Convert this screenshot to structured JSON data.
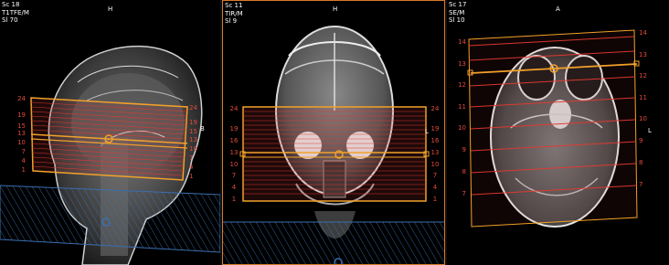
{
  "colors": {
    "slice_line": "#e23a2e",
    "stack_box": "#f2a12a",
    "saturation_band": "#3a6fb0",
    "background": "#000000"
  },
  "viewports": [
    {
      "name": "sagittal",
      "info": {
        "series": "Sc 18",
        "sequence": "T1TFE/M",
        "slice": "Sl 70"
      },
      "orientation_top": "H",
      "orientation_right": "B",
      "slice_labels_left": [
        "24",
        "19",
        "15",
        "13",
        "10",
        "7",
        "4",
        "1"
      ],
      "slice_labels_right": [
        "24",
        "19",
        "15",
        "13",
        "10",
        "7",
        "4",
        "1"
      ]
    },
    {
      "name": "coronal",
      "info": {
        "series": "Sc 11",
        "sequence": "TIR/M",
        "slice": "Sl 9"
      },
      "orientation_top": "H",
      "orientation_right": "L",
      "slice_labels_left": [
        "24",
        "19",
        "16",
        "13",
        "10",
        "7",
        "4",
        "1"
      ],
      "slice_labels_right": [
        "24",
        "19",
        "16",
        "13",
        "10",
        "7",
        "4",
        "1"
      ]
    },
    {
      "name": "axial",
      "info": {
        "series": "Sc 17",
        "sequence": "SE/M",
        "slice": "Sl 10"
      },
      "orientation_top": "A",
      "orientation_right": "L",
      "slice_labels_left": [
        "14",
        "13",
        "12",
        "11",
        "10",
        "9",
        "8",
        "7"
      ],
      "slice_labels_right": [
        "14",
        "13",
        "12",
        "11",
        "10",
        "9",
        "8",
        "7"
      ]
    }
  ]
}
